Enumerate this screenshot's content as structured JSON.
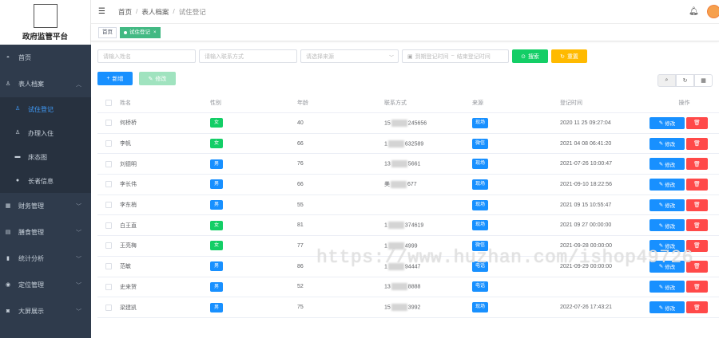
{
  "brand": {
    "title": "政府监管平台"
  },
  "sidebar": {
    "items": [
      {
        "label": "首页",
        "icon": "dashboard-icon"
      },
      {
        "label": "表人档案",
        "icon": "user-icon",
        "open": true
      },
      {
        "label": "财务管理",
        "icon": "finance-icon"
      },
      {
        "label": "膳食管理",
        "icon": "meal-icon"
      },
      {
        "label": "统计分析",
        "icon": "bar-chart-icon"
      },
      {
        "label": "定位管理",
        "icon": "location-icon"
      },
      {
        "label": "大屏展示",
        "icon": "screen-icon"
      }
    ],
    "submenu": [
      {
        "label": "试住登记",
        "active": true
      },
      {
        "label": "办理入住"
      },
      {
        "label": "床态图"
      },
      {
        "label": "长者信息"
      }
    ]
  },
  "header": {
    "breadcrumb": [
      "首页",
      "表人档案",
      "试住登记"
    ]
  },
  "tags": [
    {
      "label": "首页"
    },
    {
      "label": "试住登记",
      "active": true
    }
  ],
  "filters": {
    "name_placeholder": "请输入姓名",
    "phone_placeholder": "请输入联系方式",
    "source_placeholder": "请选择来源",
    "date_start_placeholder": "到期登记时间",
    "date_sep": "~",
    "date_end_placeholder": "结束登记时间",
    "search_label": "搜索",
    "reset_label": "重置"
  },
  "actions": {
    "add_label": "新增",
    "edit_label": "修改"
  },
  "table": {
    "headers": [
      "姓名",
      "性别",
      "年龄",
      "联系方式",
      "来源",
      "登记时间",
      "操作"
    ],
    "rows": [
      {
        "name": "何桥桥",
        "gender": "女",
        "age": "40",
        "phone_a": "15",
        "phone_b": "245656",
        "source": "现场",
        "time": "2020 11 25 09:27:04"
      },
      {
        "name": "李帆",
        "gender": "女",
        "age": "66",
        "phone_a": "1",
        "phone_b": "632589",
        "source": "微信",
        "time": "2021 04 08 06:41:20"
      },
      {
        "name": "刘德明",
        "gender": "男",
        "age": "76",
        "phone_a": "13",
        "phone_b": "5661",
        "source": "现场",
        "time": "2021-07-26 10:00:47"
      },
      {
        "name": "李长伟",
        "gender": "男",
        "age": "66",
        "phone_a": "美",
        "phone_b": "677",
        "source": "现场",
        "time": "2021-09-10 18:22:56"
      },
      {
        "name": "李东梢",
        "gender": "男",
        "age": "55",
        "phone_a": "",
        "phone_b": "",
        "source": "现场",
        "time": "2021 09 15 10:55:47"
      },
      {
        "name": "白王直",
        "gender": "女",
        "age": "81",
        "phone_a": "1",
        "phone_b": "374619",
        "source": "现场",
        "time": "2021 09 27 00:00:00"
      },
      {
        "name": "王亮梅",
        "gender": "女",
        "age": "77",
        "phone_a": "1",
        "phone_b": "4999",
        "source": "微信",
        "time": "2021-09-28 00:00:00"
      },
      {
        "name": "范敏",
        "gender": "男",
        "age": "86",
        "phone_a": "1",
        "phone_b": "94447",
        "source": "电话",
        "time": "2021-09-29 00:00:00"
      },
      {
        "name": "史来贺",
        "gender": "男",
        "age": "52",
        "phone_a": "13",
        "phone_b": "8888",
        "source": "电话",
        "time": ""
      },
      {
        "name": "梁建凯",
        "gender": "男",
        "age": "75",
        "phone_a": "15",
        "phone_b": "3992",
        "source": "现场",
        "time": "2022-07-26 17:43:21"
      }
    ],
    "edit_label": "修改"
  },
  "watermark": "https://www.huzhan.com/ishop49726",
  "colors": {
    "sidebar": "#2f3b4c",
    "primary": "#1890ff",
    "success": "#13ce66",
    "warning": "#ffba00",
    "danger": "#ff4949"
  }
}
